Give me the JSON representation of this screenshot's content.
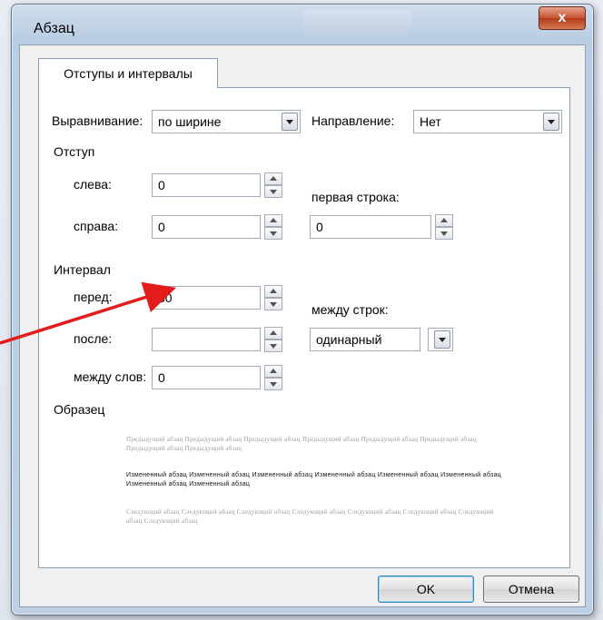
{
  "dialog": {
    "title": "Абзац",
    "close_label": "x",
    "tab_label": "Отступы и интервалы",
    "general": {
      "alignment_label": "Выравнивание:",
      "alignment_value": "по ширине",
      "direction_label": "Направление:",
      "direction_value": "Нет"
    },
    "indent": {
      "section_label": "Отступ",
      "left_label": "слева:",
      "left_value": "0",
      "right_label": "справа:",
      "right_value": "0",
      "first_line_label": "первая строка:",
      "first_line_value": "0"
    },
    "spacing": {
      "section_label": "Интервал",
      "before_label": "перед:",
      "before_value": "30",
      "after_label": "после:",
      "after_value": "",
      "word_label": "между слов:",
      "word_value": "0",
      "line_label": "между строк:",
      "line_value": "одинарный"
    },
    "preview": {
      "section_label": "Образец",
      "prev_text": "Предыдущий абзац Предыдущий абзац Предыдущий абзац Предыдущий абзац Предыдущий абзац Предыдущий абзац Предыдущий абзац Предыдущий абзац",
      "current_text": "Измененный абзац Измененный абзац Измененный абзац Измененный абзац Измененный абзац Измененный абзац Измененный абзац Измененный абзац",
      "next_text": "Следующий абзац Следующий абзац Следующий абзац Следующий абзац Следующий абзац Следующий абзац Следующий абзац Следующий абзац"
    },
    "ok_label": "OK",
    "cancel_label": "Отмена"
  },
  "colors": {
    "arrow": "#e41b1b",
    "title_gradient": "#bfd0e4",
    "close_button": "#c6512f"
  }
}
